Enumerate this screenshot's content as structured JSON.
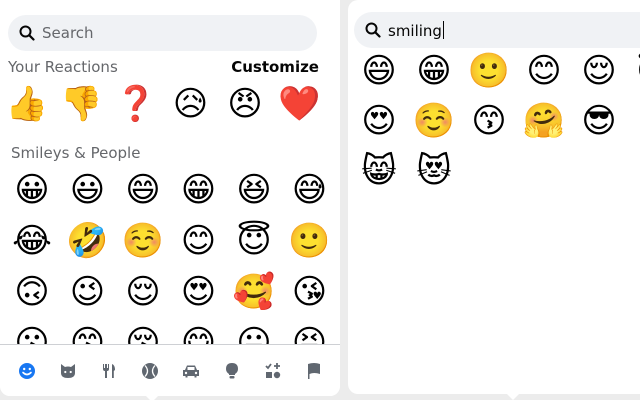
{
  "left_panel": {
    "search": {
      "placeholder": "Search",
      "icon": "search-icon"
    },
    "your_reactions": {
      "heading": "Your Reactions",
      "customize_label": "Customize",
      "items": [
        "👍",
        "👎",
        "❓",
        "😥",
        "😠",
        "❤️"
      ]
    },
    "smileys_people": {
      "heading": "Smileys & People",
      "rows": [
        [
          "😀",
          "😃",
          "😄",
          "😁",
          "😆",
          "😅"
        ],
        [
          "😂",
          "🤣",
          "☺️",
          "😊",
          "😇",
          "🙂"
        ],
        [
          "🙃",
          "😉",
          "😌",
          "😍",
          "🥰",
          "😘"
        ],
        [
          "😗",
          "😙",
          "😚",
          "😋",
          "😛",
          "😝"
        ]
      ]
    },
    "category_tabs": [
      {
        "icon": "smiley-icon",
        "active": true
      },
      {
        "icon": "cat-icon",
        "active": false
      },
      {
        "icon": "fork-knife-icon",
        "active": false
      },
      {
        "icon": "ball-icon",
        "active": false
      },
      {
        "icon": "car-icon",
        "active": false
      },
      {
        "icon": "lightbulb-icon",
        "active": false
      },
      {
        "icon": "symbols-icon",
        "active": false
      },
      {
        "icon": "flag-icon",
        "active": false
      }
    ]
  },
  "right_panel": {
    "search": {
      "value": "smiling",
      "icon": "search-icon"
    },
    "results": [
      [
        "😄",
        "😁",
        "🙂",
        "😊",
        "😌",
        "😇"
      ],
      [
        "😍",
        "☺️",
        "😙",
        "🤗",
        "😎"
      ],
      [
        "😸",
        "😻"
      ]
    ]
  },
  "colors": {
    "accent": "#1877f2",
    "icon_gray": "#606770",
    "search_bg": "#f0f2f5",
    "page_bg": "#ececec"
  }
}
